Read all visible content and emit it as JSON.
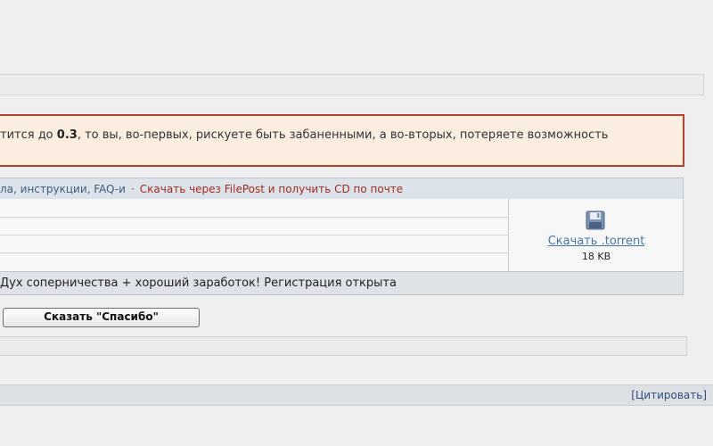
{
  "warning": {
    "prefix": "тится до ",
    "value": "0.3",
    "suffix": ", то вы, во-первых, рискуете быть забаненными, а во-вторых, потеряете возможность"
  },
  "links": {
    "help": "ла, инструкции, FAQ-и",
    "separator": "·",
    "filepost": "Скачать через FilePost и получить CD по почте"
  },
  "download": {
    "icon": "floppy-disk-icon",
    "link": "Скачать .torrent",
    "size": "18 KB"
  },
  "caption": "Дух соперничества + хороший заработок! Регистрация открыта",
  "thanks_button": "Сказать \"Спасибо\"",
  "footer": {
    "quote": "[Цитировать]"
  },
  "colors": {
    "warning_border": "#b0422e",
    "warning_bg": "#fbeee1",
    "link_blue": "#3a5d7d",
    "link_red": "#a32a1c"
  }
}
